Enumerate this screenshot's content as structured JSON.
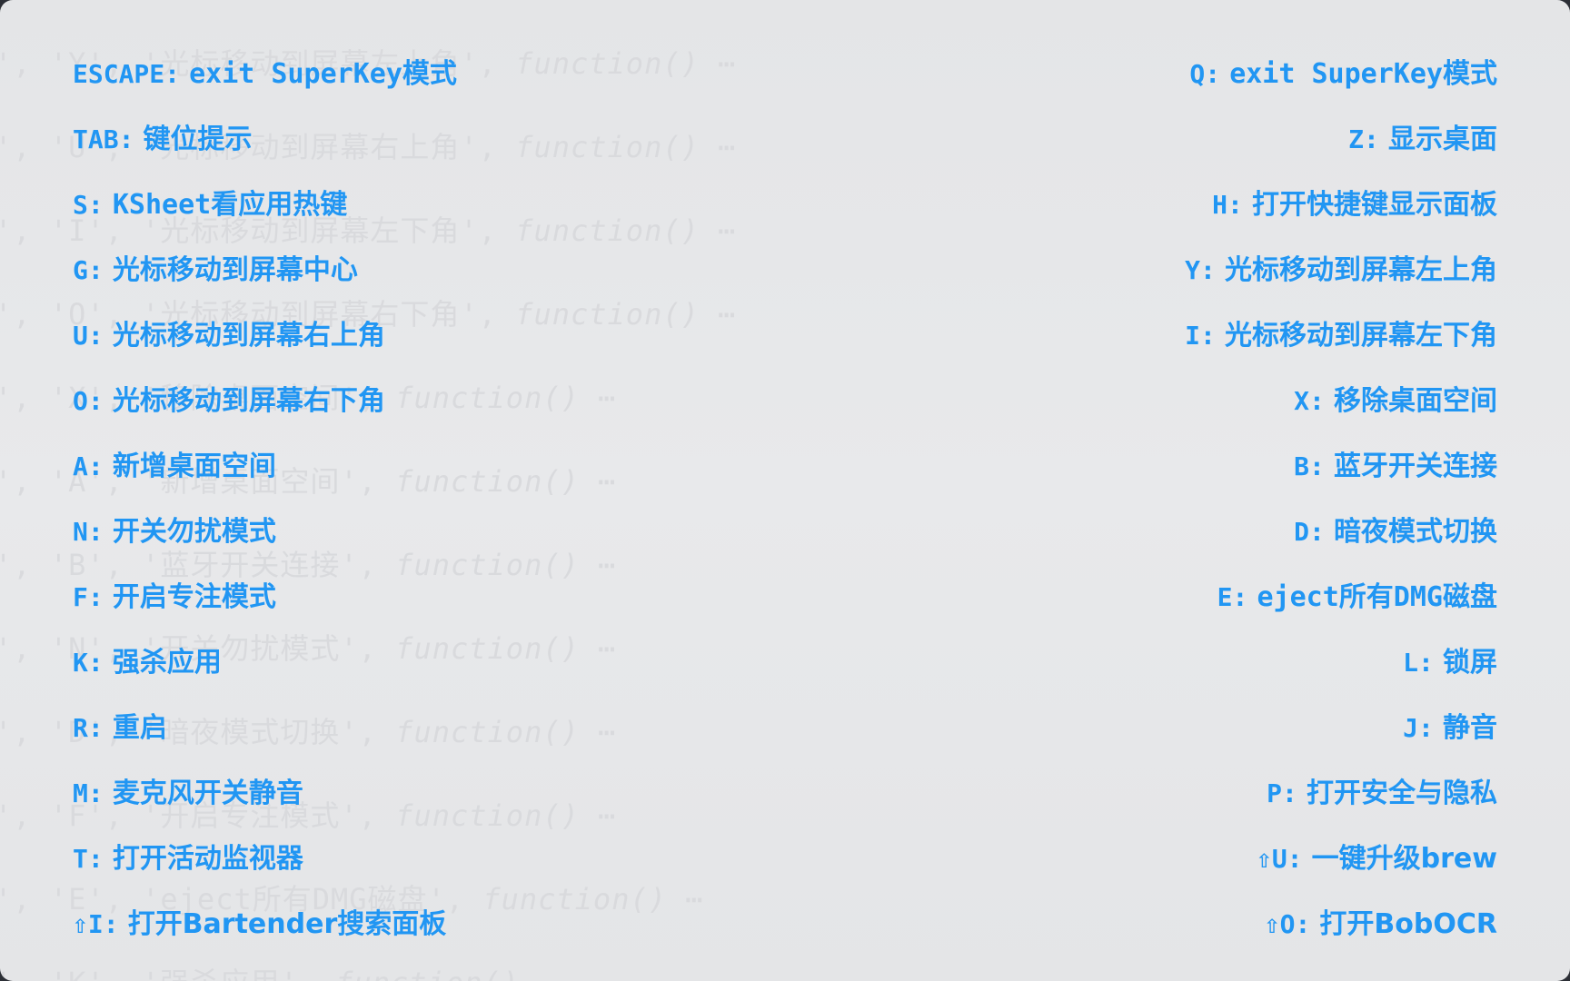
{
  "background_code": [
    {
      "text": "', 'Y', '光标移动到屏幕左上角', ",
      "fn": "function()",
      "tail": " ⋯"
    },
    {
      "text": "', 'U', '光标移动到屏幕右上角', ",
      "fn": "function()",
      "tail": " ⋯"
    },
    {
      "text": "', 'I', '光标移动到屏幕左下角', ",
      "fn": "function()",
      "tail": " ⋯"
    },
    {
      "text": "', 'O', '光标移动到屏幕右下角', ",
      "fn": "function()",
      "tail": " ⋯"
    },
    {
      "text": "', 'X', '移除桌面空间', ",
      "fn": "function()",
      "tail": " ⋯"
    },
    {
      "text": "', 'A', '新增桌面空间', ",
      "fn": "function()",
      "tail": " ⋯"
    },
    {
      "text": "', 'B', '蓝牙开关连接', ",
      "fn": "function()",
      "tail": " ⋯"
    },
    {
      "text": "', 'N', '开关勿扰模式', ",
      "fn": "function()",
      "tail": " ⋯"
    },
    {
      "text": "', 'D', '暗夜模式切换', ",
      "fn": "function()",
      "tail": " ⋯"
    },
    {
      "text": "', 'F', '开启专注模式', ",
      "fn": "function()",
      "tail": " ⋯"
    },
    {
      "text": "', 'E', 'eject所有DMG磁盘', ",
      "fn": "function()",
      "tail": " ⋯"
    },
    {
      "text": "', 'K', '强杀应用', ",
      "fn": "function()",
      "tail": " ⋯"
    }
  ],
  "left_column": [
    {
      "key": "ESCAPE:",
      "desc": "exit SuperKey模式"
    },
    {
      "key": "TAB:",
      "desc": "键位提示"
    },
    {
      "key": "S:",
      "desc": "KSheet看应用热键"
    },
    {
      "key": "G:",
      "desc": "光标移动到屏幕中心"
    },
    {
      "key": "U:",
      "desc": "光标移动到屏幕右上角"
    },
    {
      "key": "O:",
      "desc": "光标移动到屏幕右下角"
    },
    {
      "key": "A:",
      "desc": "新增桌面空间"
    },
    {
      "key": "N:",
      "desc": "开关勿扰模式"
    },
    {
      "key": "F:",
      "desc": "开启专注模式"
    },
    {
      "key": "K:",
      "desc": "强杀应用"
    },
    {
      "key": "R:",
      "desc": "重启"
    },
    {
      "key": "M:",
      "desc": "麦克风开关静音"
    },
    {
      "key": "T:",
      "desc": "打开活动监视器"
    },
    {
      "key": "⇧I:",
      "desc": "打开Bartender搜索面板"
    }
  ],
  "right_column": [
    {
      "key": "Q:",
      "desc": "exit SuperKey模式"
    },
    {
      "key": "Z:",
      "desc": "显示桌面"
    },
    {
      "key": "H:",
      "desc": "打开快捷键显示面板"
    },
    {
      "key": "Y:",
      "desc": "光标移动到屏幕左上角"
    },
    {
      "key": "I:",
      "desc": "光标移动到屏幕左下角"
    },
    {
      "key": "X:",
      "desc": "移除桌面空间"
    },
    {
      "key": "B:",
      "desc": "蓝牙开关连接"
    },
    {
      "key": "D:",
      "desc": "暗夜模式切换"
    },
    {
      "key": "E:",
      "desc": "eject所有DMG磁盘"
    },
    {
      "key": "L:",
      "desc": "锁屏"
    },
    {
      "key": "J:",
      "desc": "静音"
    },
    {
      "key": "P:",
      "desc": "打开安全与隐私"
    },
    {
      "key": "⇧U:",
      "desc": "一键升级brew"
    },
    {
      "key": "⇧O:",
      "desc": "打开BobOCR"
    }
  ],
  "colors": {
    "accent": "#2196f3",
    "panel_background": "#e6e7e9",
    "ghost_text": "#d9dadd"
  }
}
